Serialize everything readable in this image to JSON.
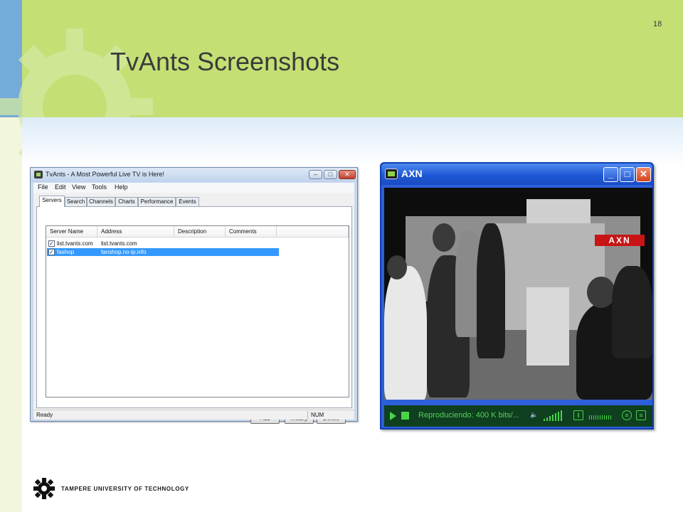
{
  "slide": {
    "number": "18",
    "title": "TvAnts Screenshots",
    "footer": "TAMPERE UNIVERSITY OF TECHNOLOGY",
    "colors": {
      "banner": "#c4df74",
      "left_strip": "#74abd8",
      "text": "#3b3b3b"
    }
  },
  "tvants_window": {
    "title": "TvAnts - A Most Powerful Live TV is Here!",
    "menu": [
      "File",
      "Edit",
      "View",
      "Tools",
      "Help"
    ],
    "tabs": [
      "Servers",
      "Search",
      "Channels",
      "Charts",
      "Performance",
      "Events"
    ],
    "active_tab": "Servers",
    "columns": [
      "Server Name",
      "Address",
      "Description",
      "Comments"
    ],
    "rows": [
      {
        "checked": true,
        "name": "list.tvants.com",
        "address": "list.tvants.com",
        "selected": false
      },
      {
        "checked": true,
        "name": "fashop",
        "address": "fanshop.no-ip.info",
        "selected": true
      }
    ],
    "buttons": {
      "add": "Add",
      "modify": "Modify",
      "delete": "Delete"
    },
    "status": {
      "left": "Ready",
      "right": "NUM"
    },
    "icons": {
      "app": "tvants-app-icon",
      "minimize": "minimize-icon",
      "maximize": "maximize-icon",
      "close": "close-icon",
      "checkbox": "checkmark-icon"
    }
  },
  "player_window": {
    "title": "AXN",
    "video_logo": "AXN",
    "status": "Reproduciendo: 400 K bits/...",
    "icons": {
      "play": "play-icon",
      "stop": "stop-icon",
      "volume": "speaker-icon",
      "eq": "equalizer-icon",
      "chat": "chat-icon",
      "list": "list-icon",
      "minimize": "minimize-icon",
      "maximize": "maximize-icon",
      "close": "close-icon"
    },
    "colors": {
      "controls_text": "#59d05c",
      "title_bar": "#2c5fd9"
    }
  }
}
